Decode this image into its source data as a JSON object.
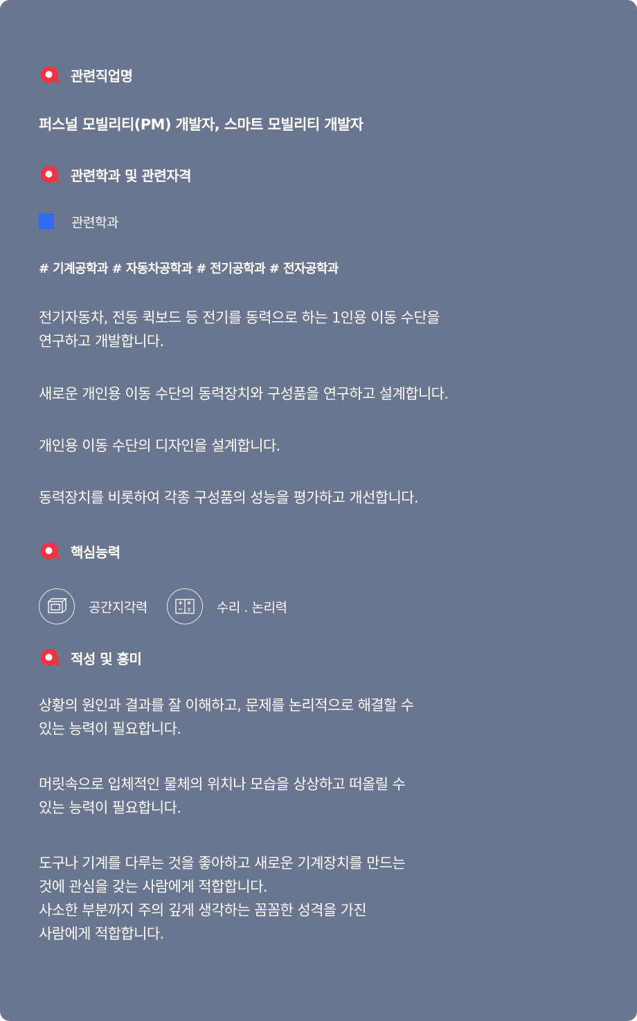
{
  "sections": {
    "related_jobs": {
      "title": "관련직업명",
      "value": "퍼스널 모빌리티(PM) 개발자, 스마트 모빌리티 개발자"
    },
    "majors_certs": {
      "title": "관련학과 및 관련자격",
      "subhead": "관련학과",
      "tags": "# 기계공학과 # 자동차공학과 # 전기공학과 # 전자공학과",
      "paragraphs": [
        "전기자동차, 전동 퀵보드 등 전기를 동력으로 하는 1인용 이동 수단을\n연구하고 개발합니다.",
        "새로운 개인용 이동 수단의 동력장치와 구성품을 연구하고 설계합니다.",
        "개인용 이동 수단의 디자인을 설계합니다.",
        "동력장치를 비롯하여 각종 구성품의 성능을 평가하고 개선합니다."
      ]
    },
    "core_abilities": {
      "title": "핵심능력",
      "items": [
        {
          "icon": "spatial-box-icon",
          "label": "공간지각력"
        },
        {
          "icon": "math-logic-icon",
          "label": "수리 . 논리력"
        }
      ]
    },
    "aptitude": {
      "title": "적성 및 흥미",
      "paragraphs": [
        "상황의 원인과 결과를 잘 이해하고, 문제를 논리적으로 해결할 수\n있는 능력이 필요합니다.",
        "머릿속으로 입체적인 물체의 위치나 모습을 상상하고 떠올릴 수\n있는 능력이 필요합니다.",
        "도구나 기계를 다루는 것을 좋아하고 새로운 기계장치를 만드는\n것에 관심을 갖는 사람에게 적합합니다.\n사소한 부분까지 주의 깊게 생각하는 꼼꼼한 성격을 가진\n사람에게 적합합니다."
      ]
    }
  },
  "colors": {
    "background": "#6a7590",
    "accent_red": "#ee3443",
    "accent_blue": "#2f6cf6",
    "text": "#ffffff"
  }
}
